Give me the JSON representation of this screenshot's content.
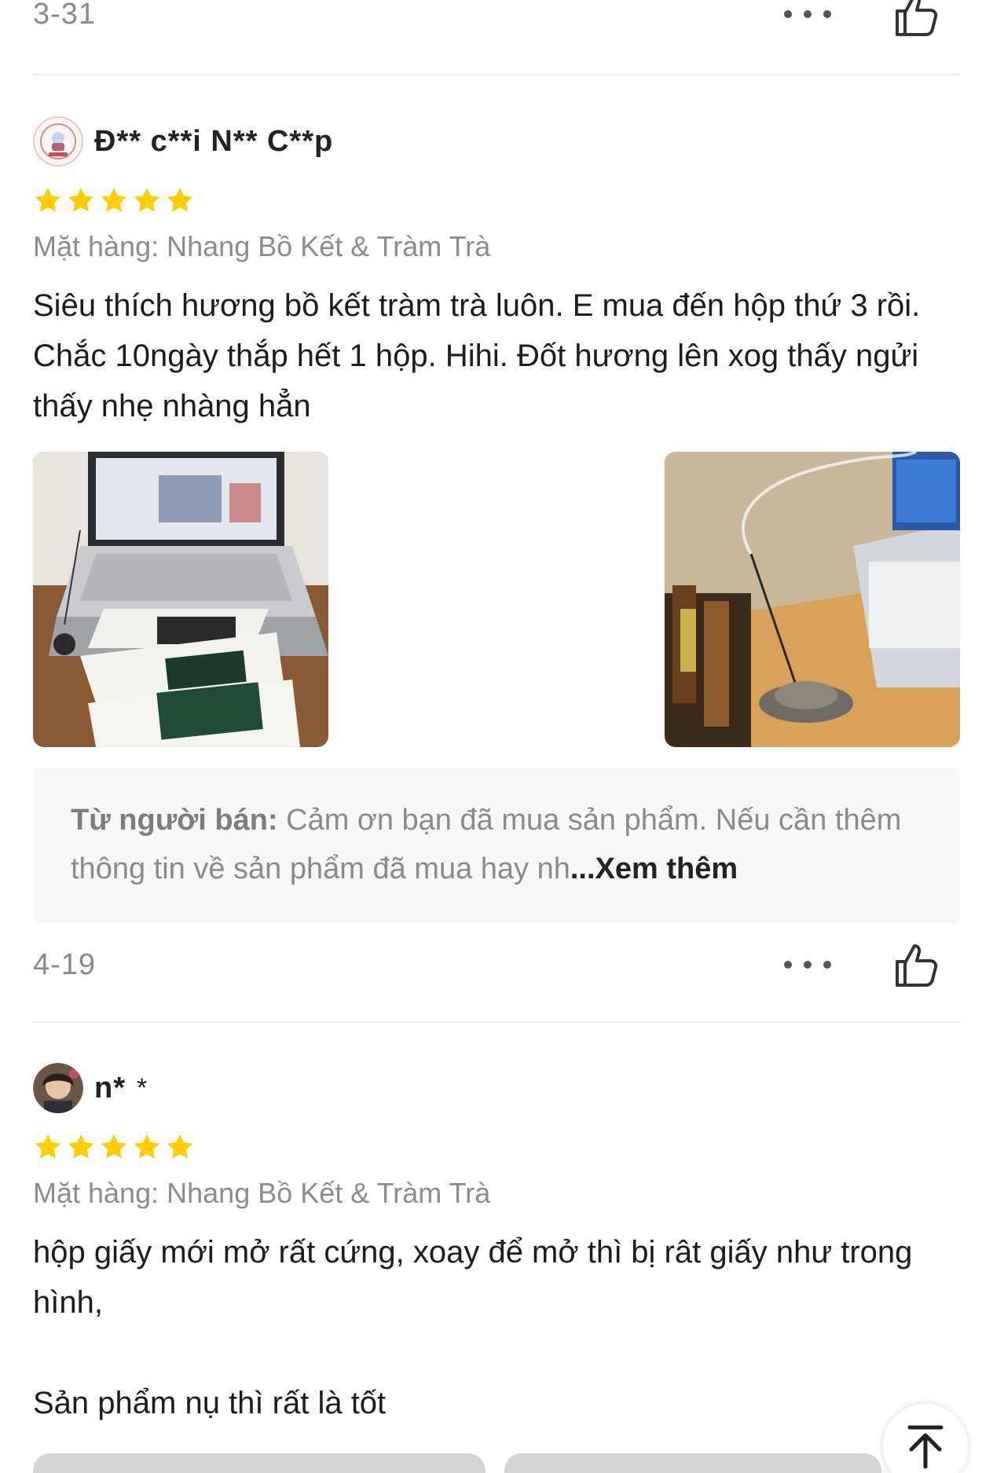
{
  "prev_review": {
    "date": "3-31"
  },
  "reviews": [
    {
      "author": "Đ** c**i N** C**p",
      "rating": 5,
      "variant_label": "Mặt hàng:",
      "variant_value": "Nhang Bồ Kết & Tràm Trà",
      "text": "Siêu thích hương bồ kết tràm trà luôn. E mua đến hộp thứ 3 rồi. Chắc 10ngày thắp hết 1 hộp. Hihi. Đốt hương lên xog thấy ngửi thấy nhẹ nhàng hẳn",
      "photos": [
        "laptop-incense-boxes-photo",
        "incense-burner-desk-photo"
      ],
      "seller_reply": {
        "label": "Từ người bán:",
        "text": " Cảm ơn bạn đã mua sản phẩm. Nếu cần thêm thông tin về sản phẩm đã mua hay nh",
        "more": "...Xem thêm"
      },
      "date": "4-19"
    },
    {
      "author": "n*",
      "author_suffix": "*",
      "rating": 5,
      "variant_label": "Mặt hàng:",
      "variant_value": "Nhang Bồ Kết & Tràm Trà",
      "text": "hộp giấy mới mở rất cứng, xoay để mở thì bị rât giấy như trong hình,\n\nSản phẩm nụ thì rất là tốt"
    }
  ],
  "colors": {
    "star": "#FFCC00",
    "muted_text": "#8a8a8a",
    "seller_bg": "#f7f7f8"
  },
  "icons": {
    "more": "more-dots-icon",
    "like": "thumbs-up-icon",
    "scroll_top": "scroll-to-top-icon"
  }
}
